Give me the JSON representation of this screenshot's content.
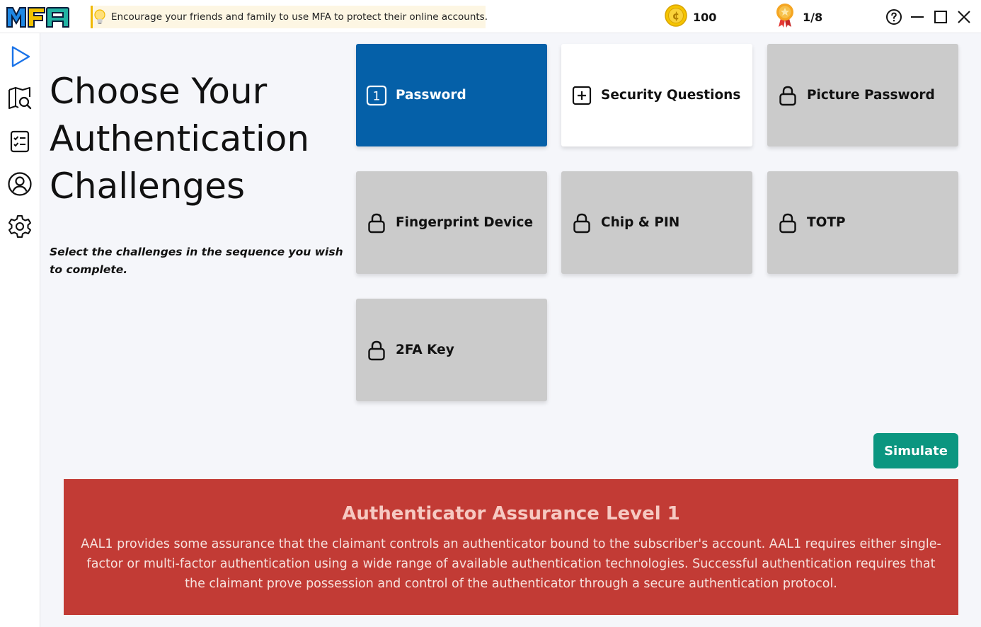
{
  "app": {
    "logo_text": "MFA",
    "tip": "Encourage your friends and family to use MFA to protect their online accounts.",
    "coins": "100",
    "progress": "1/8"
  },
  "window_controls": [
    "help-icon",
    "minimize-icon",
    "maximize-icon",
    "close-icon"
  ],
  "sidebar": {
    "items": [
      {
        "icon": "play-icon"
      },
      {
        "icon": "map-search-icon"
      },
      {
        "icon": "checklist-icon"
      },
      {
        "icon": "user-circle-icon"
      },
      {
        "icon": "gear-icon"
      }
    ]
  },
  "main": {
    "title_lines": [
      "Choose Your",
      "Authentication",
      "Challenges"
    ],
    "instruction": "Select the challenges in the sequence you wish to complete."
  },
  "challenges": [
    {
      "label": "Password",
      "state": "selected",
      "order": "1",
      "icon": "number-badge-icon"
    },
    {
      "label": "Security Questions",
      "state": "available",
      "icon": "plus-square-icon"
    },
    {
      "label": "Picture Password",
      "state": "locked",
      "icon": "lock-icon"
    },
    {
      "label": "Fingerprint Device",
      "state": "locked",
      "icon": "lock-icon"
    },
    {
      "label": "Chip & PIN",
      "state": "locked",
      "icon": "lock-icon"
    },
    {
      "label": "TOTP",
      "state": "locked",
      "icon": "lock-icon"
    },
    {
      "label": "2FA Key",
      "state": "locked",
      "icon": "lock-icon"
    }
  ],
  "actions": {
    "simulate_label": "Simulate"
  },
  "aal": {
    "title": "Authenticator Assurance Level 1",
    "body": "AAL1 provides some assurance that the claimant controls an authenticator bound to the subscriber's account. AAL1 requires either single-factor or multi-factor authentication using a wide range of available authentication technologies. Successful authentication requires that the claimant prove possession and control of the authenticator through a secure authentication protocol."
  },
  "colors": {
    "selected": "#0560a8",
    "locked": "#cbcbcb",
    "simulate": "#0b9680",
    "aal_bg": "#c23b35"
  }
}
